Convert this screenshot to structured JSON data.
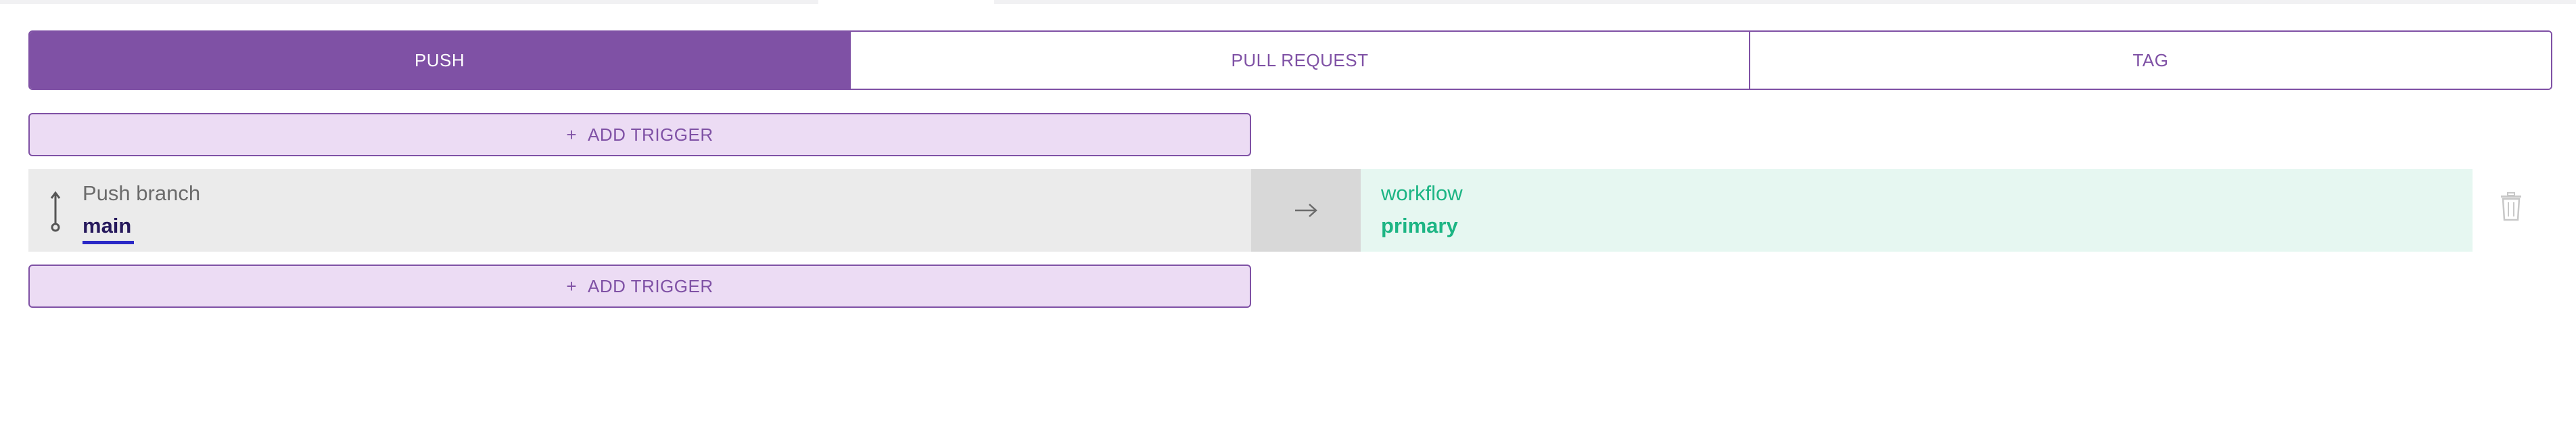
{
  "tabs": [
    {
      "label": "PUSH",
      "active": true
    },
    {
      "label": "PULL REQUEST",
      "active": false
    },
    {
      "label": "TAG",
      "active": false
    }
  ],
  "add_trigger": {
    "plus": "+",
    "label": "ADD TRIGGER"
  },
  "trigger": {
    "title": "Push branch",
    "branch": "main",
    "arrow_icon": "arrow-right-icon",
    "target_type": "workflow",
    "target_name": "primary",
    "delete_icon": "trash-icon"
  },
  "colors": {
    "accent": "#7f51a5",
    "accent_light": "#ecdcf4",
    "target_green": "#1db584",
    "target_bg": "#e6f7f1"
  }
}
